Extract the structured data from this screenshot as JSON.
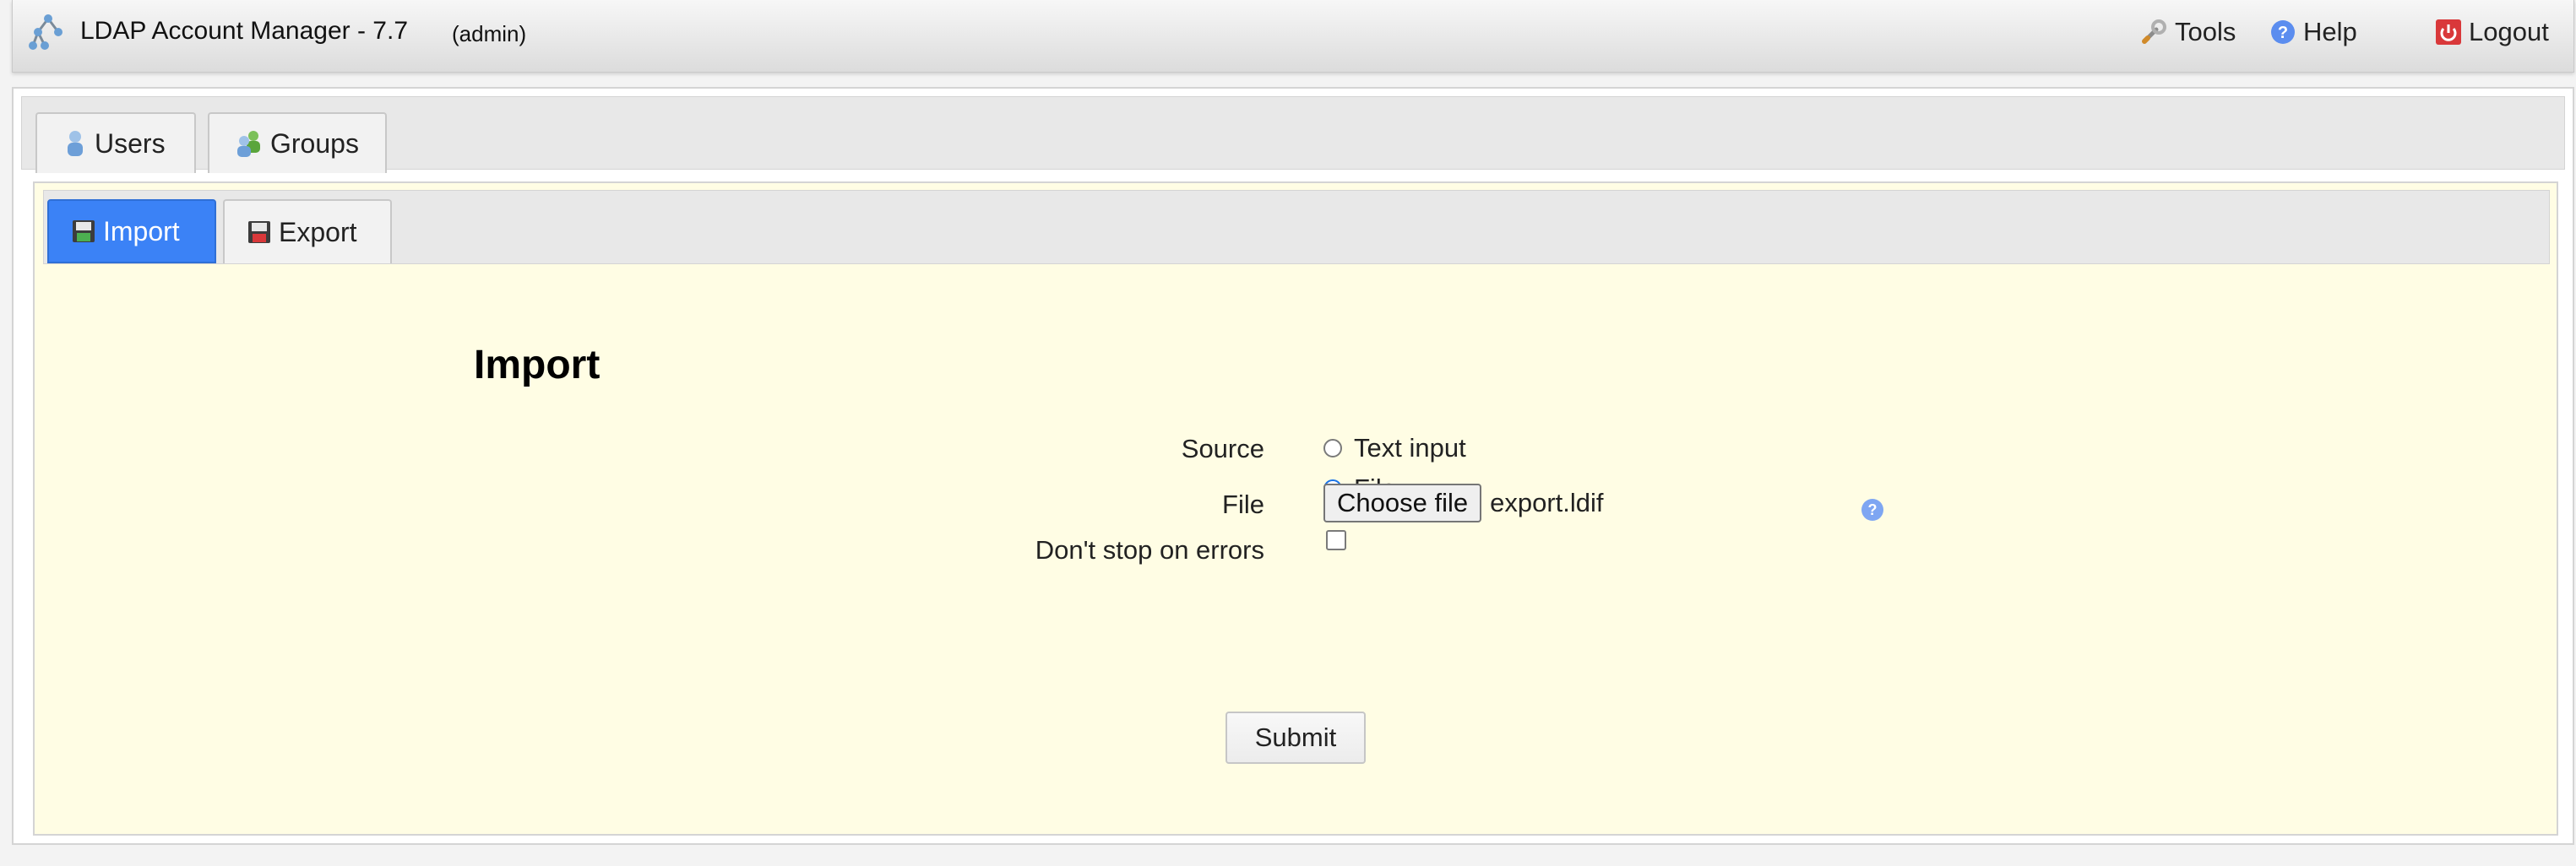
{
  "header": {
    "app_title": "LDAP Account Manager - 7.7",
    "user": "(admin)",
    "menu": {
      "tools": "Tools",
      "help": "Help",
      "logout": "Logout"
    }
  },
  "main_tabs": [
    {
      "label": "Users",
      "icon": "user-icon"
    },
    {
      "label": "Groups",
      "icon": "group-icon"
    }
  ],
  "sub_tabs": [
    {
      "label": "Import",
      "icon": "import-icon",
      "active": true
    },
    {
      "label": "Export",
      "icon": "export-icon",
      "active": false
    }
  ],
  "form": {
    "title": "Import",
    "source_label": "Source",
    "source_options": [
      {
        "label": "Text input",
        "checked": false
      },
      {
        "label": "File",
        "checked": true
      }
    ],
    "file_label": "File",
    "choose_file_button": "Choose file",
    "file_name": "export.ldif",
    "dont_stop_label": "Don't stop on errors",
    "dont_stop_checked": false,
    "submit_label": "Submit"
  },
  "colors": {
    "active_tab": "#3b82f6",
    "form_background": "#fffde4",
    "help_icon": "#5b8def",
    "logout_icon": "#d9383a"
  }
}
